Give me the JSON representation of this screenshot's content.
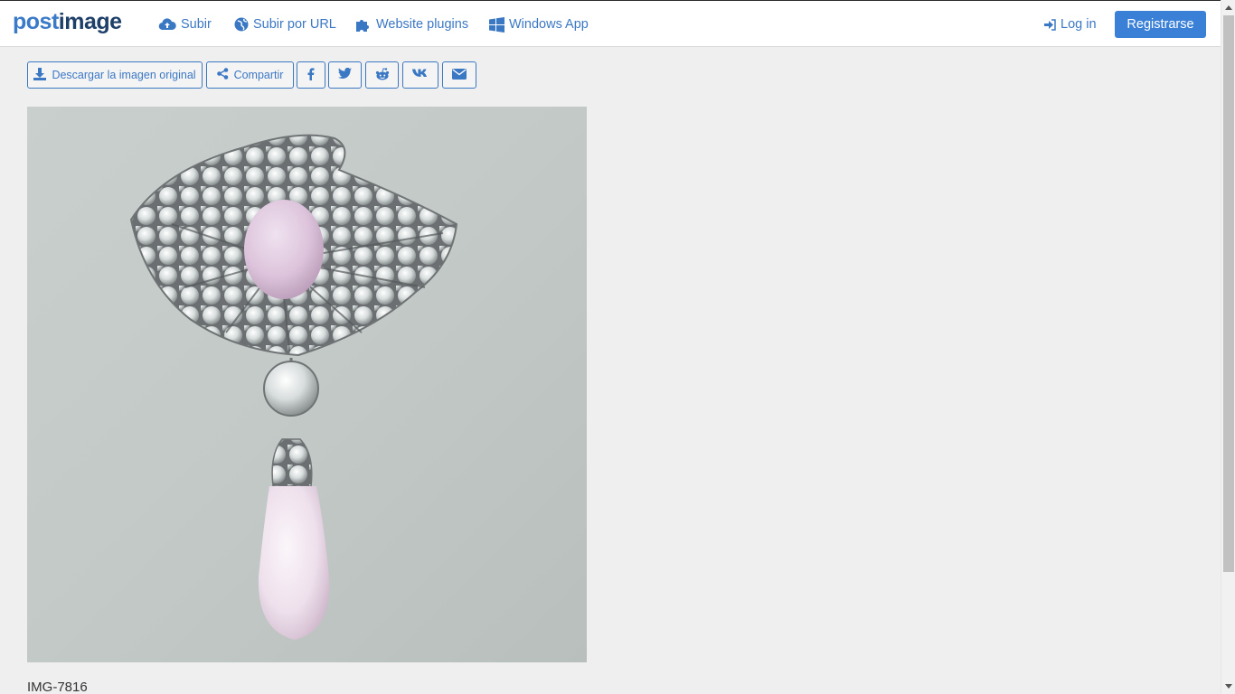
{
  "brand": {
    "logo_left": "post",
    "logo_right": "image"
  },
  "nav": {
    "upload": "Subir",
    "upload_url": "Subir por URL",
    "plugins": "Website plugins",
    "windows_app": "Windows App",
    "login": "Log in",
    "register": "Registrarse"
  },
  "actions": {
    "download": "Descargar la imagen original",
    "share": "Compartir",
    "social": [
      "facebook-icon",
      "twitter-icon",
      "reddit-icon",
      "vk-icon",
      "envelope-icon"
    ]
  },
  "image": {
    "caption": "IMG-7816"
  },
  "colors": {
    "accent": "#3a80d6",
    "link": "#3b78c4",
    "background": "#efefef"
  }
}
